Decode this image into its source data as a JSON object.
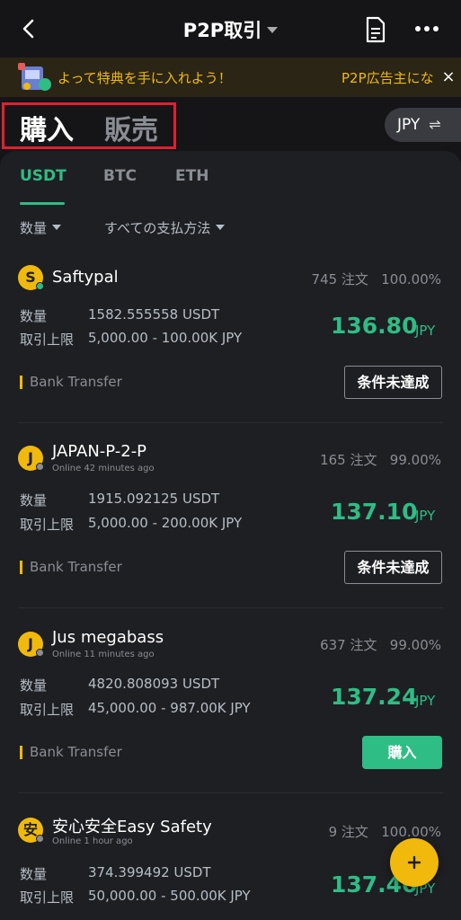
{
  "header": {
    "title": "P2P取引",
    "back_icon": "back-arrow-icon",
    "doc_icon": "document-icon",
    "more_icon": "more-icon"
  },
  "banner": {
    "text": "よって特典を手に入れよう！",
    "text2": "P2P広告主にな",
    "close": "×"
  },
  "trade": {
    "buy": "購入",
    "sell": "販売",
    "currency": "JPY",
    "swap": "⇌"
  },
  "coins": [
    "USDT",
    "BTC",
    "ETH"
  ],
  "filters": {
    "amount": "数量",
    "payment": "すべての支払方法"
  },
  "labels": {
    "qty": "数量",
    "limit": "取引上限",
    "price_currency": "JPY"
  },
  "ads": [
    {
      "initial": "S",
      "name": "Saftypal",
      "online": "",
      "orders": "745 注文",
      "completion": "100.00%",
      "quantity": "1582.555558 USDT",
      "limit": "5,000.00 - 100.00K JPY",
      "price": "136.80",
      "payment": "Bank Transfer",
      "action": "条件未達成"
    },
    {
      "initial": "J",
      "name": "JAPAN-P-2-P",
      "online": "Online 42 minutes ago",
      "orders": "165 注文",
      "completion": "99.00%",
      "quantity": "1915.092125 USDT",
      "limit": "5,000.00 - 200.00K JPY",
      "price": "137.10",
      "payment": "Bank Transfer",
      "action": "条件未達成"
    },
    {
      "initial": "J",
      "name": "Jus megabass",
      "online": "Online 11 minutes ago",
      "orders": "637 注文",
      "completion": "99.00%",
      "quantity": "4820.808093 USDT",
      "limit": "45,000.00 - 987.00K JPY",
      "price": "137.24",
      "payment": "Bank Transfer",
      "action": "購入"
    },
    {
      "initial": "安",
      "name": "安心安全Easy Safety",
      "online": "Online 1 hour ago",
      "orders": "9 注文",
      "completion": "100.00%",
      "quantity": "374.399492 USDT",
      "limit": "50,000.00 - 500.00K JPY",
      "price": "137.40",
      "payment": "",
      "action": ""
    }
  ],
  "fab": "+",
  "colors": {
    "accent_green": "#2ebd85",
    "accent_yellow": "#f0b90b",
    "highlight_red": "#e02030"
  }
}
